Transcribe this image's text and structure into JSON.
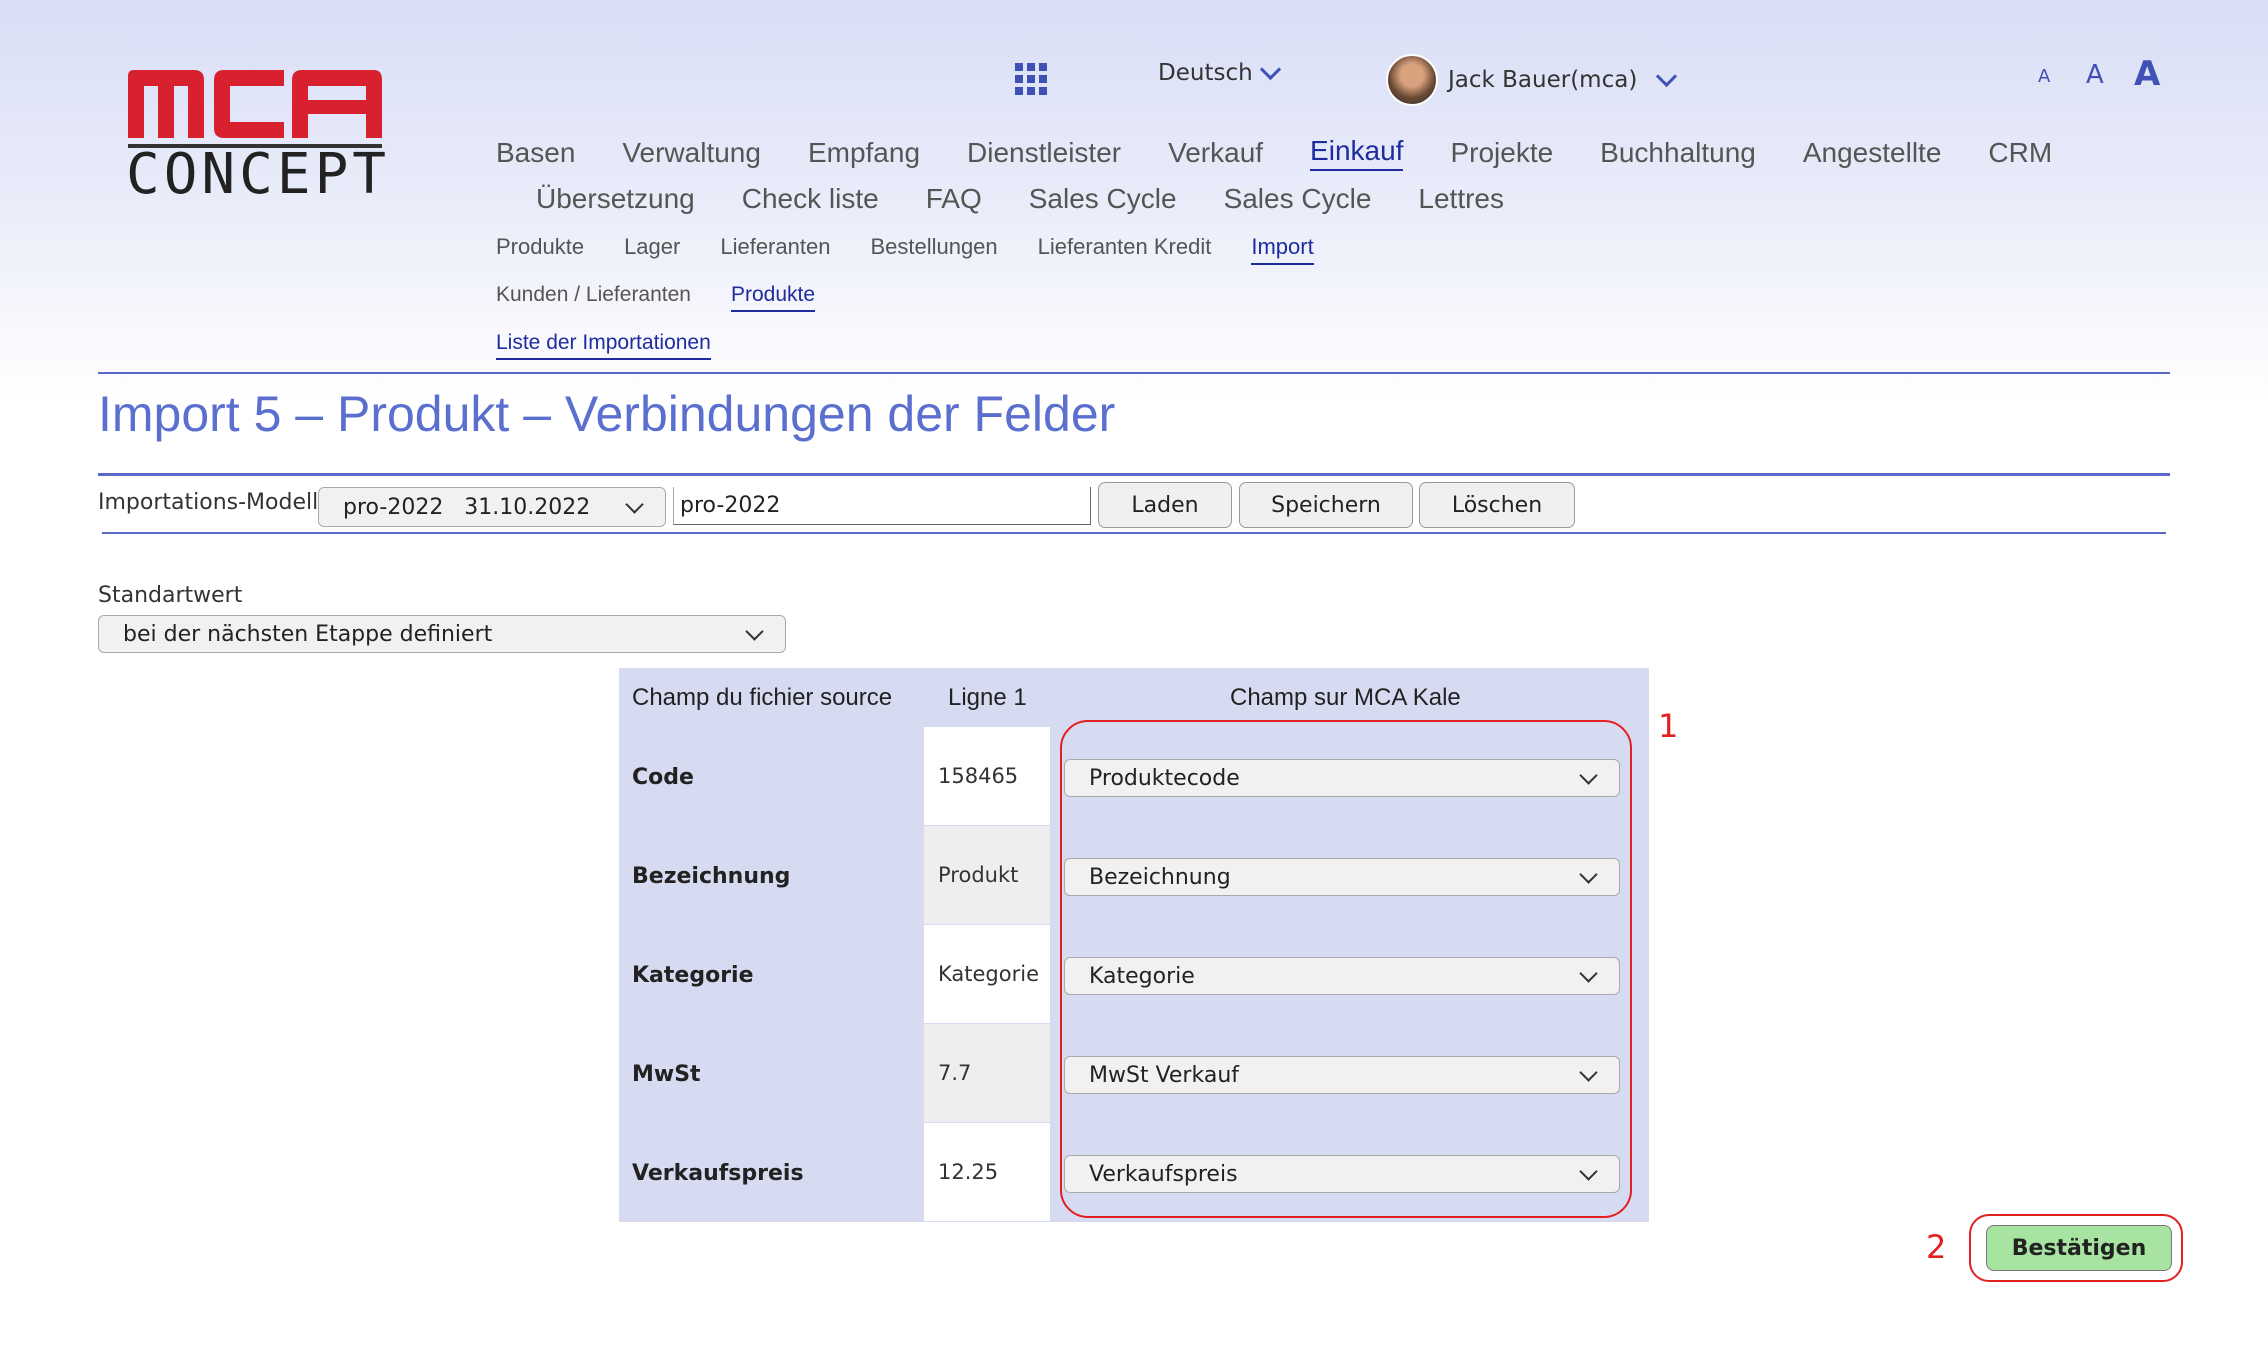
{
  "logo": {
    "top_text": "MCA",
    "bottom_text": "CONCEPT"
  },
  "header": {
    "language": "Deutsch",
    "user": "Jack Bauer(mca)",
    "font_sizes": [
      "A",
      "A",
      "A"
    ]
  },
  "nav": {
    "main_row1": [
      "Basen",
      "Verwaltung",
      "Empfang",
      "Dienstleister",
      "Verkauf",
      "Einkauf",
      "Projekte",
      "Buchhaltung",
      "Angestellte",
      "CRM"
    ],
    "main_row2": [
      "Übersetzung",
      "Check liste",
      "FAQ",
      "Sales Cycle",
      "Sales Cycle",
      "Lettres"
    ],
    "active_main": "Einkauf",
    "sub": [
      "Produkte",
      "Lager",
      "Lieferanten",
      "Bestellungen",
      "Lieferanten Kredit",
      "Import"
    ],
    "sub2": [
      "Kunden / Lieferanten",
      "Produkte"
    ],
    "sub3": [
      "Liste der Importationen"
    ]
  },
  "page": {
    "title": "Import 5 – Produkt – Verbindungen der Felder",
    "model_label": "Importations-Modell",
    "model_select": "pro-2022   31.10.2022",
    "model_name": "pro-2022",
    "btn_load": "Laden",
    "btn_save": "Speichern",
    "btn_delete": "Löschen",
    "default_label": "Standartwert",
    "default_select": "bei der nächsten Etappe definiert"
  },
  "mapping": {
    "headers": [
      "Champ du fichier source",
      "Ligne 1",
      "Champ sur MCA Kale"
    ],
    "rows": [
      {
        "source": "Code",
        "line1": "158465",
        "target": "Produktecode"
      },
      {
        "source": "Bezeichnung",
        "line1": "Produkt",
        "target": "Bezeichnung"
      },
      {
        "source": "Kategorie",
        "line1": "Kategorie",
        "target": "Kategorie"
      },
      {
        "source": "MwSt",
        "line1": "7.7",
        "target": "MwSt Verkauf"
      },
      {
        "source": "Verkaufspreis",
        "line1": "12.25",
        "target": "Verkaufspreis"
      }
    ]
  },
  "annotations": {
    "marker1": "1",
    "marker2": "2"
  },
  "confirm_label": "Bestätigen",
  "colors": {
    "accent": "#1e2ca0",
    "title": "#5b6fd0",
    "highlight": "#e32020",
    "confirm": "#a7e4a2",
    "logo_red": "#d8202e"
  }
}
